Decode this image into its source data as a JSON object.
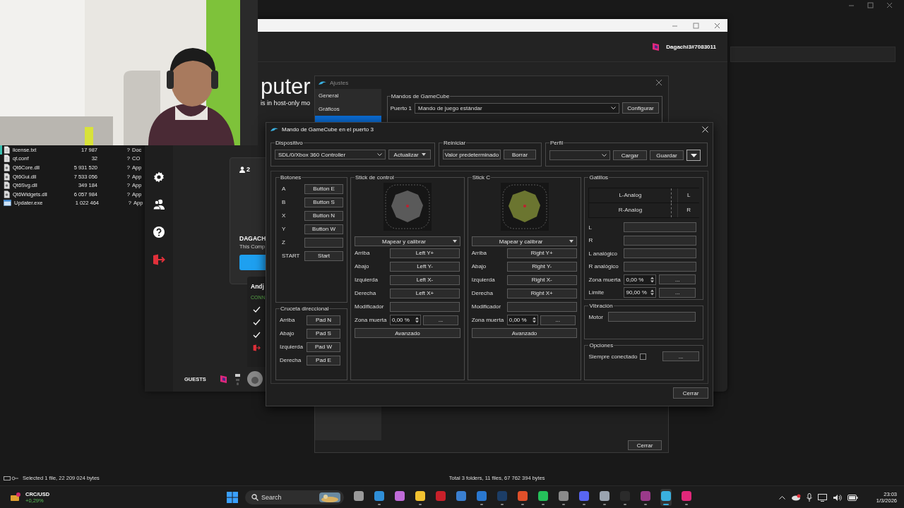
{
  "explorer": {
    "files": [
      {
        "name": "license.txt",
        "size": "17 987",
        "col3": "?",
        "type": "Doc",
        "kind": "text",
        "selected": true
      },
      {
        "name": "qt.conf",
        "size": "32",
        "col3": "?",
        "type": "CO",
        "kind": "text",
        "selected": false
      },
      {
        "name": "Qt6Core.dll",
        "size": "5 931 520",
        "col3": "?",
        "type": "App",
        "kind": "dll",
        "selected": false
      },
      {
        "name": "Qt6Gui.dll",
        "size": "7 533 056",
        "col3": "?",
        "type": "App",
        "kind": "dll",
        "selected": false
      },
      {
        "name": "Qt6Svg.dll",
        "size": "349 184",
        "col3": "?",
        "type": "App",
        "kind": "dll",
        "selected": false
      },
      {
        "name": "Qt6Widgets.dll",
        "size": "6 057 984",
        "col3": "?",
        "type": "App",
        "kind": "dll",
        "selected": false
      },
      {
        "name": "Updater.exe",
        "size": "1 022 464",
        "col3": "?",
        "type": "App",
        "kind": "exe",
        "selected": false
      }
    ],
    "status_left": "Selected 1 file, 22 209 024 bytes",
    "status_right": "Total 3 folders, 11 files, 67 762 394 bytes"
  },
  "host_app": {
    "user": "Dagachi3#7083011",
    "heading": "puter",
    "subtitle": "is in host-only mo",
    "sidebar": [
      {
        "kind": "settings"
      },
      {
        "kind": "friends"
      },
      {
        "kind": "help"
      },
      {
        "kind": "exit"
      }
    ],
    "card": {
      "count": "2",
      "name": "DAGACH",
      "description": "This Comp"
    },
    "guest": {
      "name": "Andj",
      "status": "CONN",
      "actions": [
        {
          "kind": "check"
        },
        {
          "kind": "check"
        },
        {
          "kind": "check"
        },
        {
          "kind": "exit"
        }
      ]
    },
    "footer": "GUESTS"
  },
  "settings_dialog": {
    "title": "Ajustes",
    "nav": [
      {
        "label": "General",
        "selected": false
      },
      {
        "label": "Gráficos",
        "selected": false
      },
      {
        "selected": true
      }
    ],
    "group": "Mandos de GameCube",
    "port_label": "Puerto 1",
    "port_value": "Mando de juego estándar",
    "configure": "Configurar",
    "close": "Cerrar"
  },
  "gc_dialog": {
    "title": "Mando de GameCube en el puerto 3",
    "device": {
      "title": "Dispositivo",
      "value": "SDL/0/Xbox 360 Controller",
      "refresh": "Actualizar"
    },
    "reset": {
      "title": "Reiniciar",
      "buttons": [
        "Valor predeterminado",
        "Borrar"
      ]
    },
    "profile": {
      "title": "Perfil",
      "load": "Cargar",
      "save": "Guardar"
    },
    "buttons": {
      "title": "Botones",
      "rows": [
        {
          "label": "A",
          "binding": "Button E"
        },
        {
          "label": "B",
          "binding": "Button S"
        },
        {
          "label": "X",
          "binding": "Button N"
        },
        {
          "label": "Y",
          "binding": "Button W"
        },
        {
          "label": "Z"
        },
        {
          "label": "START",
          "binding": "Start"
        }
      ]
    },
    "dpad": {
      "title": "Cruceta direccional",
      "rows": [
        {
          "label": "Arriba",
          "binding": "Pad N"
        },
        {
          "label": "Abajo",
          "binding": "Pad S"
        },
        {
          "label": "Izquierda",
          "binding": "Pad W"
        },
        {
          "label": "Derecha",
          "binding": "Pad E"
        }
      ]
    },
    "sticks": [
      {
        "title": "Stick de control",
        "color": "#5a5a5a",
        "map": "Mapear y calibrar",
        "rows": [
          {
            "label": "Arriba",
            "binding": "Left Y+"
          },
          {
            "label": "Abajo",
            "binding": "Left Y-"
          },
          {
            "label": "Izquierda",
            "binding": "Left X-"
          },
          {
            "label": "Derecha",
            "binding": "Left X+"
          },
          {
            "label": "Modificador"
          }
        ],
        "deadzone_label": "Zona muerta",
        "deadzone": "0,00 %",
        "more": "...",
        "advanced": "Avanzado"
      },
      {
        "title": "Stick C",
        "color": "#6b7530",
        "map": "Mapear y calibrar",
        "rows": [
          {
            "label": "Arriba",
            "binding": "Right Y+"
          },
          {
            "label": "Abajo",
            "binding": "Right Y-"
          },
          {
            "label": "Izquierda",
            "binding": "Right X-"
          },
          {
            "label": "Derecha",
            "binding": "Right X+"
          },
          {
            "label": "Modificador"
          }
        ],
        "deadzone_label": "Zona muerta",
        "deadzone": "0,00 %",
        "more": "...",
        "advanced": "Avanzado"
      }
    ],
    "triggers": {
      "title": "Gatillos",
      "meters": [
        {
          "name": "L-Analog",
          "key": "L"
        },
        {
          "name": "R-Analog",
          "key": "R"
        }
      ],
      "rows": [
        {
          "label": "L",
          "kind": "field"
        },
        {
          "label": "R",
          "kind": "field"
        },
        {
          "label": "L analógico",
          "kind": "field"
        },
        {
          "label": "R analógico",
          "kind": "field"
        },
        {
          "label": "Zona muerta",
          "kind": "spin",
          "value": "0,00 %",
          "more": "..."
        },
        {
          "label": "Límite",
          "kind": "spin",
          "value": "90,00 %",
          "more": "..."
        }
      ]
    },
    "vibration": {
      "title": "Vibración",
      "label": "Motor"
    },
    "options": {
      "title": "Opciones",
      "label": "Siempre conectado",
      "checked": false,
      "more": "..."
    },
    "close": "Cerrar"
  },
  "taskbar": {
    "widget": {
      "title": "CRC/USD",
      "change": "+0,29%"
    },
    "search": {
      "placeholder": "Search"
    },
    "apps": [
      {
        "color": "#9a9a9a",
        "running": false,
        "selected": false
      },
      {
        "color": "#2f8fd8",
        "running": true,
        "selected": false
      },
      {
        "color": "#c06bd8",
        "running": false,
        "selected": false
      },
      {
        "color": "#f2c230",
        "running": true,
        "selected": false
      },
      {
        "color": "#c8202a",
        "running": false,
        "selected": false
      },
      {
        "color": "#3a7fd0",
        "running": false,
        "selected": false
      },
      {
        "color": "#2a78d0",
        "running": true,
        "selected": false
      },
      {
        "color": "#1c3d66",
        "running": true,
        "selected": false
      },
      {
        "color": "#e0502a",
        "running": true,
        "selected": false
      },
      {
        "color": "#25c05a",
        "running": true,
        "selected": false
      },
      {
        "color": "#8a8a8a",
        "running": true,
        "selected": false
      },
      {
        "color": "#5865f2",
        "running": true,
        "selected": false
      },
      {
        "color": "#9aa4b0",
        "running": true,
        "selected": false
      },
      {
        "color": "#2b2b2b",
        "running": true,
        "selected": false
      },
      {
        "color": "#9a3a8a",
        "running": true,
        "selected": false
      },
      {
        "color": "#3ab0e0",
        "running": true,
        "selected": true
      },
      {
        "color": "#e0287a",
        "running": true,
        "selected": false
      }
    ],
    "time": "23:03",
    "date": "1/3/2026"
  }
}
